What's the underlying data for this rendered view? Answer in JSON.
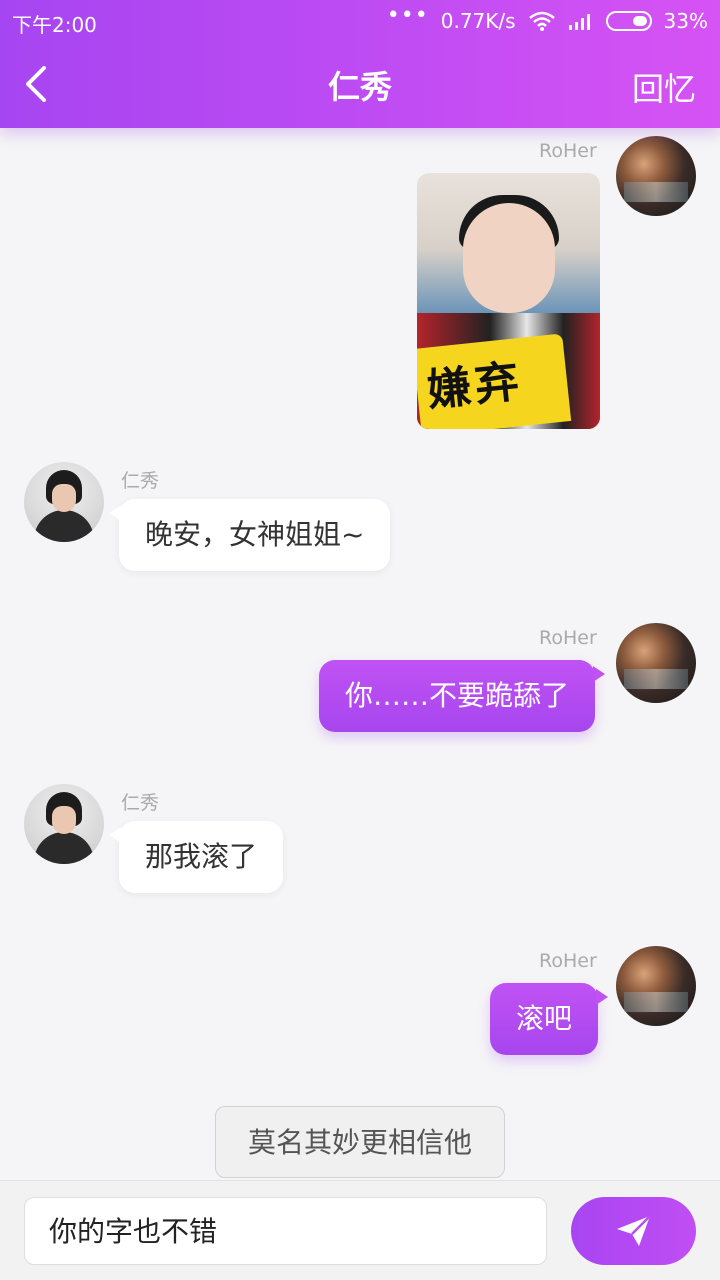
{
  "status_bar": {
    "time": "下午2:00",
    "dots": "•••",
    "network_speed": "0.77K/s",
    "battery": "33%"
  },
  "header": {
    "title": "仁秀",
    "right_action": "回忆",
    "back_icon": "chevron-left-icon"
  },
  "messages": [
    {
      "sender": "RoHer",
      "type": "image",
      "sticker_text": "嫌弃"
    },
    {
      "sender": "仁秀",
      "type": "text",
      "text": "晚安，女神姐姐~"
    },
    {
      "sender": "RoHer",
      "type": "text",
      "text": "你……不要跪舔了"
    },
    {
      "sender": "仁秀",
      "type": "text",
      "text": "那我滚了"
    },
    {
      "sender": "RoHer",
      "type": "text",
      "text": "滚吧"
    }
  ],
  "suggestion": {
    "text": "莫名其妙更相信他"
  },
  "composer": {
    "value": "你的字也不错",
    "send_icon": "paper-plane-icon"
  },
  "colors": {
    "accent_start": "#a645f2",
    "accent_end": "#d653f4",
    "outgoing_bubble": "#b84ef2",
    "incoming_bubble": "#ffffff",
    "background": "#f5f5f7"
  }
}
